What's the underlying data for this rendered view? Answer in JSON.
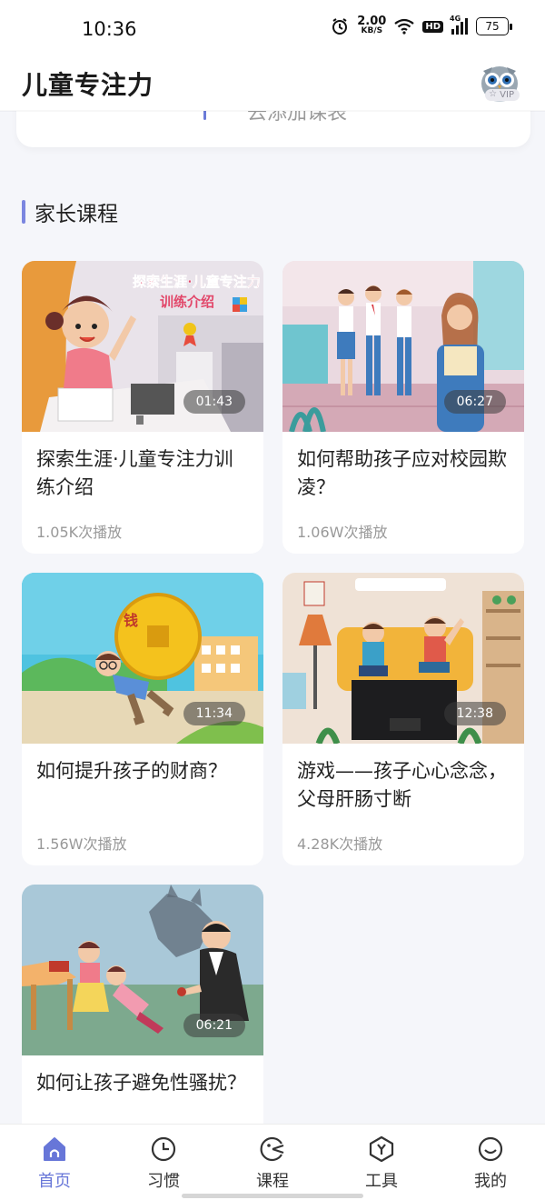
{
  "status_bar": {
    "time": "10:36",
    "net_speed_value": "2.00",
    "net_speed_unit": "KB/S",
    "hd": "HD",
    "network": "4G",
    "battery": "75"
  },
  "header": {
    "title": "儿童专注力",
    "vip_label": "VIP"
  },
  "top_card": {
    "partial_text": "去添加课表"
  },
  "section": {
    "title": "家长课程"
  },
  "courses": [
    {
      "title": "探索生涯·儿童专注力训练介绍",
      "duration": "01:43",
      "plays": "1.05K次播放",
      "thumb_caption_1": "探索生涯·儿童专注力",
      "thumb_caption_2": "训练介绍"
    },
    {
      "title": "如何帮助孩子应对校园欺凌？",
      "duration": "06:27",
      "plays": "1.06W次播放"
    },
    {
      "title": "如何提升孩子的财商？",
      "duration": "11:34",
      "plays": "1.56W次播放",
      "thumb_caption_1": "钱"
    },
    {
      "title": "游戏——孩子心心念念，父母肝肠寸断",
      "duration": "12:38",
      "plays": "4.28K次播放"
    },
    {
      "title": "如何让孩子避免性骚扰？",
      "duration": "06:21",
      "plays": ""
    }
  ],
  "nav": {
    "items": [
      {
        "label": "首页",
        "icon": "home-icon",
        "active": true
      },
      {
        "label": "习惯",
        "icon": "clock-icon",
        "active": false
      },
      {
        "label": "课程",
        "icon": "course-icon",
        "active": false
      },
      {
        "label": "工具",
        "icon": "tools-icon",
        "active": false
      },
      {
        "label": "我的",
        "icon": "smile-icon",
        "active": false
      }
    ]
  },
  "colors": {
    "accent": "#6776d8",
    "section_bar": "#7b86e0",
    "background": "#f5f6fa"
  }
}
